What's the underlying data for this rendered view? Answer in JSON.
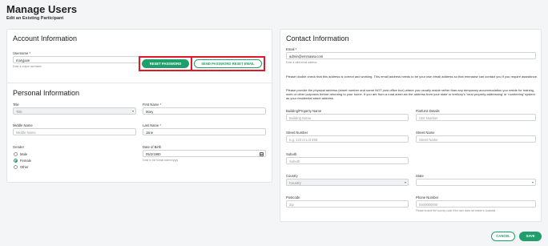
{
  "page": {
    "title": "Manage Users",
    "subtitle": "Edit an Existing Participant"
  },
  "account": {
    "heading": "Account Information",
    "username_label": "Username *",
    "username_value": "maryjane",
    "username_hint": "Enter a unique username",
    "reset_password_label": "RESET PASSWORD",
    "send_reset_email_label": "SEND PASSWORD RESET EMAIL"
  },
  "personal": {
    "heading": "Personal Information",
    "title_label": "Title",
    "title_value": "Title",
    "first_name_label": "First Name *",
    "first_name_value": "Mary",
    "middle_name_label": "Middle Name",
    "middle_name_placeholder": "Middle Name",
    "last_name_label": "Last Name *",
    "last_name_value": "Jane",
    "gender_label": "Gender",
    "gender_options": [
      "Male",
      "Female",
      "Other"
    ],
    "gender_selected": "Female",
    "dob_label": "Date of Birth",
    "dob_value": "05/2/1980",
    "dob_hint": "Enter in the format dd/mm/yyyy"
  },
  "contact": {
    "heading": "Contact Information",
    "email_label": "Email *",
    "email_value": "admin@emmaww.com",
    "email_hint": "Enter a valid email address",
    "para1": "Please double check that this address is correct and working. This email address needs to be your own email address so that emmaww can contact you if you require assistance.",
    "para2": "Please provide the physical address (street number and name NOT post office box) where you usually reside rather than any temporary accommodation you reside for training, work or other purposes before returning to your home. If you are from a rural area use the address from your state or territory's 'rural property addressing' or 'numbering' system as your residential street address.",
    "building_label": "Building/Property Name",
    "building_placeholder": "Building Name",
    "flat_label": "Flat/Unit Details",
    "flat_placeholder": "Unit Number",
    "street_number_label": "Street Number",
    "street_number_placeholder": "e.g. 123 or Lot 456",
    "street_name_label": "Street Name",
    "street_name_placeholder": "Street Name",
    "suburb_label": "Suburb",
    "suburb_placeholder": "Suburb",
    "country_label": "Country",
    "country_value": "Country",
    "state_label": "State",
    "state_value": "",
    "postcode_label": "Postcode",
    "postcode_placeholder": "Zip",
    "phone_label": "Phone Number",
    "phone_placeholder": "0400000000",
    "phone_hint": "Please include the country code if the user does not reside in Australia"
  },
  "footer": {
    "cancel_label": "CANCEL",
    "save_label": "SAVE"
  },
  "colors": {
    "accent": "#1e9f6b",
    "highlight": "#e0182a"
  }
}
